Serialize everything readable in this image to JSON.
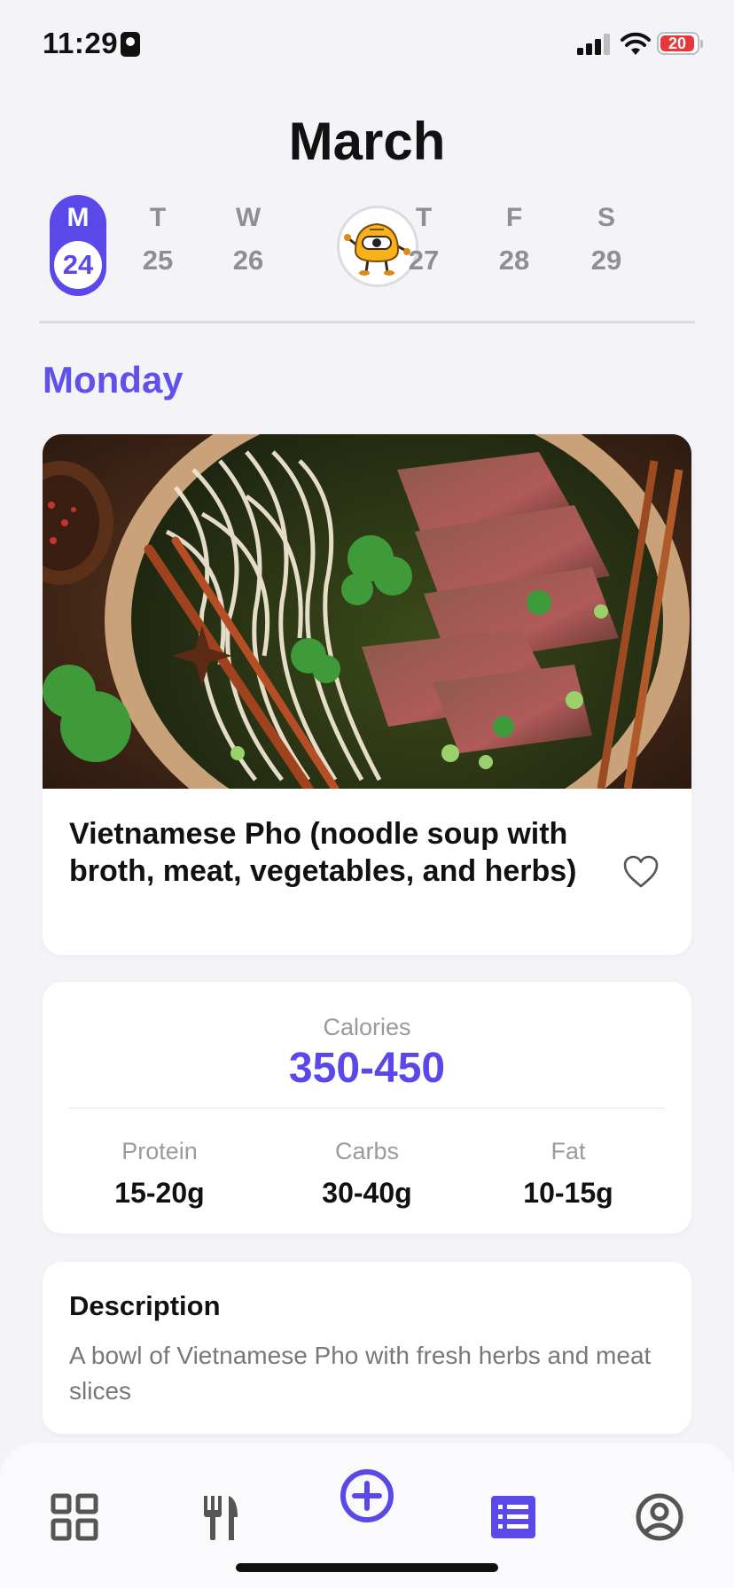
{
  "status": {
    "time": "11:29",
    "battery": "20"
  },
  "calendar": {
    "month": "March",
    "days": [
      {
        "letter": "M",
        "num": "24",
        "selected": true
      },
      {
        "letter": "T",
        "num": "25"
      },
      {
        "letter": "W",
        "num": "26"
      },
      {
        "letter": "T",
        "num": "27"
      },
      {
        "letter": "F",
        "num": "28"
      },
      {
        "letter": "S",
        "num": "29"
      }
    ]
  },
  "selected_day_name": "Monday",
  "meal": {
    "title": "Vietnamese Pho (noodle soup with broth, meat, vegetables, and herbs)"
  },
  "nutrition": {
    "calories_label": "Calories",
    "calories_value": "350-450",
    "macros": [
      {
        "label": "Protein",
        "value": "15-20g"
      },
      {
        "label": "Carbs",
        "value": "30-40g"
      },
      {
        "label": "Fat",
        "value": "10-15g"
      }
    ]
  },
  "description": {
    "heading": "Description",
    "text": "A bowl of Vietnamese Pho with fresh herbs and meat slices"
  },
  "tabbar": {
    "tabs": [
      {
        "icon": "dashboard-icon"
      },
      {
        "icon": "fork-knife-icon"
      },
      {
        "icon": "add-circle-icon"
      },
      {
        "icon": "list-icon",
        "active": true
      },
      {
        "icon": "profile-icon"
      }
    ]
  },
  "colors": {
    "accent": "#5b48e8",
    "background": "#f3f3f8",
    "battery_low": "#e8363b"
  }
}
